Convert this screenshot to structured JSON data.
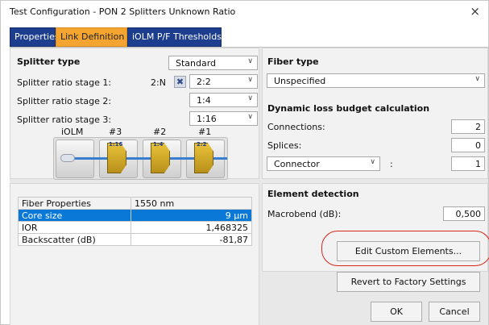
{
  "window": {
    "title": "Test Configuration - PON 2 Splitters Unknown Ratio",
    "close_glyph": "×"
  },
  "tabs": [
    {
      "label": "Properties",
      "active": false
    },
    {
      "label": "Link Definition",
      "active": true
    },
    {
      "label": "iOLM P/F Thresholds",
      "active": false
    }
  ],
  "splitter": {
    "header": "Splitter type",
    "type_value": "Standard",
    "stage1_label": "Splitter ratio stage 1:",
    "stage1_prefix": "2:N",
    "stage1_value": "2:2",
    "stage2_label": "Splitter ratio stage 2:",
    "stage2_value": "1:4",
    "stage3_label": "Splitter ratio stage 3:",
    "stage3_value": "1:16",
    "remove_icon": "close-x-icon"
  },
  "diagram": {
    "labels": [
      "iOLM",
      "#3",
      "#2",
      "#1"
    ],
    "splitter_labels": [
      "1:16",
      "1:4",
      "2:2"
    ],
    "fiber_color": "#3a7fcf",
    "splitter_color": "#d4aa2a"
  },
  "fiber_properties": {
    "headers": [
      "Fiber Properties",
      "1550 nm"
    ],
    "rows": [
      {
        "name": "Core size",
        "value": "9 µm",
        "selected": true
      },
      {
        "name": "IOR",
        "value": "1,468325",
        "selected": false
      },
      {
        "name": "Backscatter (dB)",
        "value": "-81,87",
        "selected": false
      }
    ]
  },
  "fiber_type": {
    "header": "Fiber type",
    "value": "Unspecified"
  },
  "loss_budget": {
    "header": "Dynamic loss budget calculation",
    "connections_label": "Connections:",
    "connections_value": "2",
    "splices_label": "Splices:",
    "splices_value": "0",
    "element_value": "Connector",
    "element_colon": ":",
    "element_count": "1"
  },
  "element_detection": {
    "header": "Element detection",
    "macrobend_label": "Macrobend (dB):",
    "macrobend_value": "0,500"
  },
  "buttons": {
    "edit_custom": "Edit Custom Elements...",
    "revert": "Revert to Factory Settings",
    "ok": "OK",
    "cancel": "Cancel"
  },
  "colors": {
    "tab_active": "#f4a531",
    "tab_inactive": "#1d3d8f",
    "selection": "#0a78d6",
    "highlight_oval": "#d9261c"
  }
}
